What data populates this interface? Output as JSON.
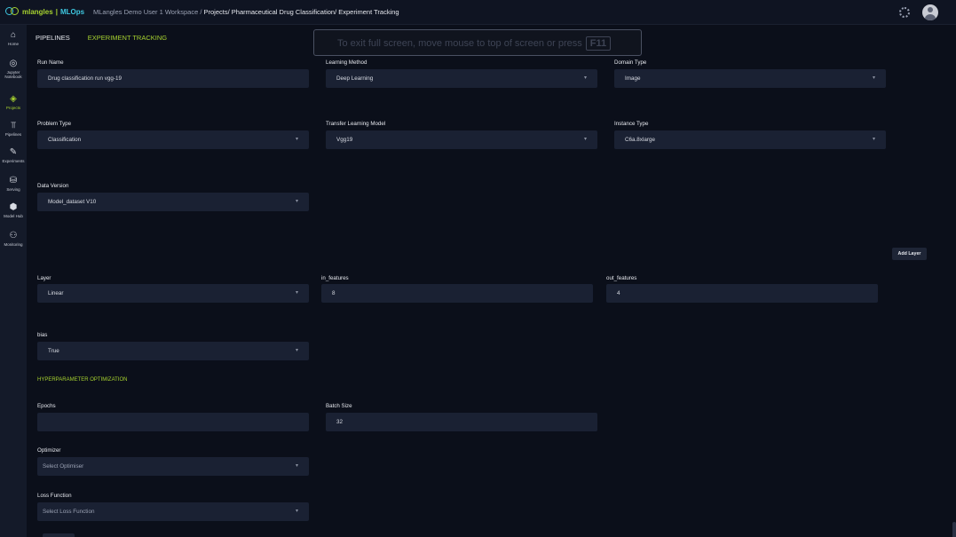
{
  "header": {
    "logo_ml": "mlangles",
    "logo_sep": "|",
    "logo_ops": "MLOps",
    "workspace": "MLangles Demo User 1 Workspace /",
    "path": "Projects/ Pharmaceutical Drug Classification/ Experiment Tracking"
  },
  "sidebar": {
    "items": [
      {
        "label": "Home",
        "icon": "home-icon"
      },
      {
        "label": "Jupyter Notebook",
        "icon": "jupyter-icon"
      },
      {
        "label": "Projects",
        "icon": "projects-icon"
      },
      {
        "label": "Pipelines",
        "icon": "pipelines-icon"
      },
      {
        "label": "Experiments",
        "icon": "experiments-icon"
      },
      {
        "label": "Serving",
        "icon": "serving-icon"
      },
      {
        "label": "Model Hub",
        "icon": "model-hub-icon"
      },
      {
        "label": "Monitoring",
        "icon": "monitoring-icon"
      }
    ],
    "active": "Projects"
  },
  "tabs": {
    "pipelines": "PIPELINES",
    "experiment_tracking": "EXPERIMENT TRACKING"
  },
  "toast": {
    "text": "To exit full screen, move mouse to top of screen or press",
    "key": "F11"
  },
  "form": {
    "run_name": {
      "label": "Run Name",
      "value": "Drug classification run vgg-19"
    },
    "learning_method": {
      "label": "Learning Method",
      "value": "Deep Learning"
    },
    "domain_type": {
      "label": "Domain Type",
      "value": "Image"
    },
    "problem_type": {
      "label": "Problem Type",
      "value": "Classification"
    },
    "transfer_model": {
      "label": "Transfer Learning Model",
      "value": "Vgg19"
    },
    "instance_type": {
      "label": "Instance Type",
      "value": "C6a.8xlarge"
    },
    "data_version": {
      "label": "Data Version",
      "value": "Model_dataset V10"
    },
    "add_layer": "Add Layer",
    "layer": {
      "label": "Layer",
      "value": "Linear"
    },
    "in_features": {
      "label": "in_features",
      "value": "8"
    },
    "out_features": {
      "label": "out_features",
      "value": "4"
    },
    "bias": {
      "label": "bias",
      "value": "True"
    }
  },
  "hpo": {
    "title": "HYPERPARAMETER OPTIMIZATION",
    "epochs": {
      "label": "Epochs",
      "value": ""
    },
    "batch_size": {
      "label": "Batch Size",
      "value": "32"
    },
    "optimizer": {
      "label": "Optimizer",
      "placeholder": "Select Optimiser"
    },
    "loss_function": {
      "label": "Loss Function",
      "placeholder": "Select Loss Function"
    }
  },
  "colors": {
    "accent": "#a6d12f",
    "background": "#0b0f1a",
    "field": "#1a2133",
    "sidebar": "#141a29"
  }
}
